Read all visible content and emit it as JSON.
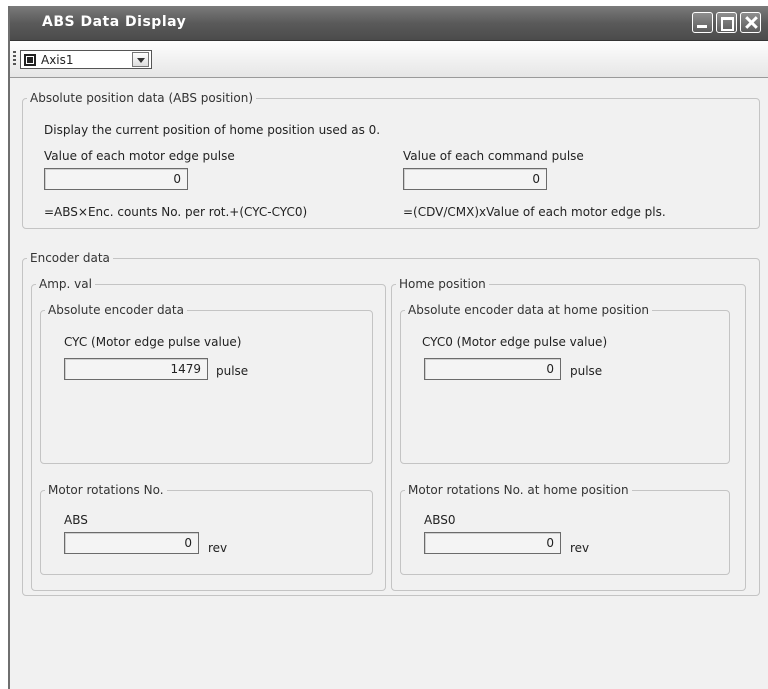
{
  "window": {
    "title": "ABS Data Display"
  },
  "toolbar": {
    "axis_value": "Axis1"
  },
  "abs_position": {
    "legend": "Absolute position data (ABS position)",
    "description": "Display the current position of home position used as 0.",
    "motor_edge_label": "Value of each motor edge pulse",
    "motor_edge_value": "0",
    "motor_edge_formula": "=ABS×Enc. counts No. per rot.+(CYC-CYC0)",
    "command_label": "Value of each command pulse",
    "command_value": "0",
    "command_formula": "=(CDV/CMX)xValue of each motor edge pls."
  },
  "encoder": {
    "legend": "Encoder data",
    "amp": {
      "legend": "Amp. val",
      "abs_encoder": {
        "legend": "Absolute encoder data",
        "label": "CYC (Motor edge pulse value)",
        "value": "1479",
        "unit": "pulse"
      },
      "rotations": {
        "legend": "Motor rotations No.",
        "label": "ABS",
        "value": "0",
        "unit": "rev"
      }
    },
    "home": {
      "legend": "Home position",
      "abs_encoder": {
        "legend": "Absolute encoder data at home position",
        "label": "CYC0 (Motor edge pulse value)",
        "value": "0",
        "unit": "pulse"
      },
      "rotations": {
        "legend": "Motor rotations No. at home position",
        "label": "ABS0",
        "value": "0",
        "unit": "rev"
      }
    }
  }
}
